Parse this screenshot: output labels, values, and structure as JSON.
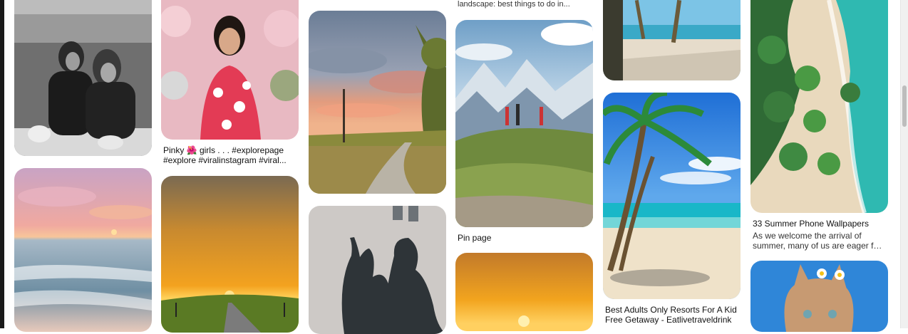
{
  "top_cut_text": "landscape: best things to do in...",
  "pins": [
    {
      "id": "couple-bw",
      "title": "",
      "subtitle": ""
    },
    {
      "id": "pinky-girl",
      "title": "Pinky 🌺 girls . . . #explorepage #explore #viralinstagram #viral...",
      "subtitle": ""
    },
    {
      "id": "sunset-road-country",
      "title": "",
      "subtitle": ""
    },
    {
      "id": "mountain-hikers",
      "title": "Pin page",
      "subtitle": ""
    },
    {
      "id": "beach-palms-top",
      "title": "",
      "subtitle": ""
    },
    {
      "id": "aerial-beach",
      "title": "33 Summer Phone Wallpapers",
      "subtitle": "As we welcome the arrival of summer, many of us are eager for t..."
    },
    {
      "id": "pastel-sea",
      "title": "",
      "subtitle": ""
    },
    {
      "id": "sunset-highway",
      "title": "",
      "subtitle": ""
    },
    {
      "id": "shadow-heart",
      "title": "",
      "subtitle": ""
    },
    {
      "id": "orange-sunset",
      "title": "",
      "subtitle": ""
    },
    {
      "id": "palm-tropical",
      "title": "Best Adults Only Resorts For A Kid Free Getaway - Eatlivetraveldrink",
      "subtitle": ""
    },
    {
      "id": "flower-cat",
      "title": "",
      "subtitle": ""
    }
  ]
}
